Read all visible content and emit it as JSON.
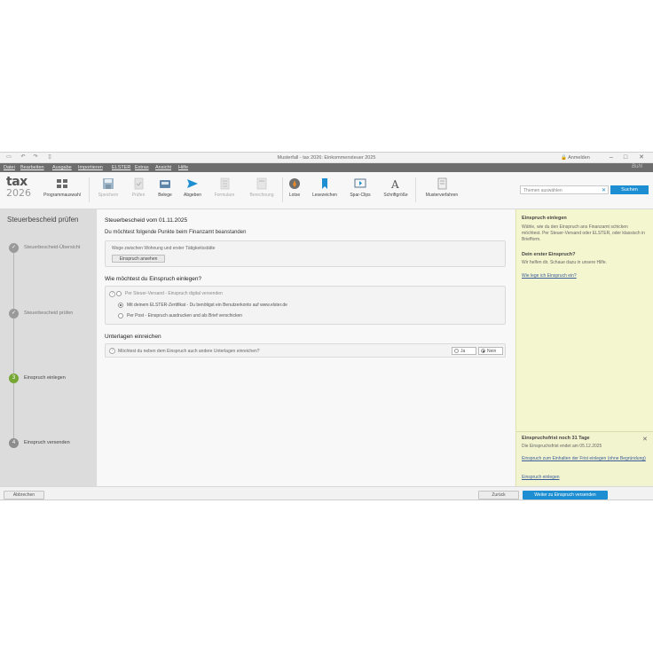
{
  "window": {
    "title": "Musterfall - tax 2026: Einkommensteuer 2025",
    "login_label": "Anmelden"
  },
  "menu": [
    "Datei",
    "Bearbeiten",
    "Ausgabe",
    "Importieren",
    "ELSTER",
    "Extras",
    "Ansicht",
    "Hilfe"
  ],
  "brand": "Buhl",
  "logo": {
    "line1": "tax",
    "line2": "2026"
  },
  "ribbon": [
    {
      "label": "Programmauswahl",
      "icon": "grid-icon",
      "disabled": false
    },
    {
      "label": "Speichern",
      "icon": "save-icon",
      "disabled": true
    },
    {
      "label": "Prüfen",
      "icon": "check-document-icon",
      "disabled": true
    },
    {
      "label": "Belege",
      "icon": "inbox-icon",
      "disabled": false
    },
    {
      "label": "Abgeben",
      "icon": "send-icon",
      "disabled": false
    },
    {
      "label": "Formulare",
      "icon": "form-icon",
      "disabled": true
    },
    {
      "label": "Berechnung",
      "icon": "calculator-icon",
      "disabled": true
    },
    {
      "label": "Lotse",
      "icon": "compass-icon",
      "disabled": false
    },
    {
      "label": "Lesezeichen",
      "icon": "bookmark-icon",
      "disabled": false
    },
    {
      "label": "Spar-Clips",
      "icon": "play-icon",
      "disabled": false
    },
    {
      "label": "Schriftgröße",
      "icon": "font-size-icon",
      "disabled": false
    },
    {
      "label": "Musterverfahren",
      "icon": "document-icon",
      "disabled": false
    }
  ],
  "search": {
    "placeholder": "Themen auswählen",
    "button": "Suchen"
  },
  "leftnav": {
    "title": "Steuerbescheid prüfen",
    "steps": [
      {
        "label": "Steuerbescheid-Übersicht",
        "marker": "✓",
        "state": "done"
      },
      {
        "label": "Steuerbescheid prüfen",
        "marker": "✓",
        "state": "done"
      },
      {
        "label": "Einspruch einlegen",
        "marker": "3",
        "state": "active"
      },
      {
        "label": "Einspruch versenden",
        "marker": "4",
        "state": "future"
      }
    ]
  },
  "main": {
    "heading": "Steuerbescheid vom 01.11.2025",
    "complaint_heading": "Du möchtest folgende Punkte beim Finanzamt beanstanden",
    "complaint_item": "Wege zwischen Wohnung und erster Tätigkeitsstätte",
    "complaint_button": "Einspruch ansehen",
    "method_heading": "Wie möchtest du Einspruch einlegen?",
    "options": [
      {
        "label": "Per Steuer-Versand - Einspruch digital versenden",
        "selected": false,
        "dim": true
      },
      {
        "label": "Mit deinem ELSTER-Zertifikat - Du benötigst ein Benutzerkonto auf www.elster.de",
        "selected": true,
        "dim": false
      },
      {
        "label": "Per Post - Einspruch ausdrucken und als Brief verschicken",
        "selected": false,
        "dim": false
      }
    ],
    "docs_heading": "Unterlagen einreichen",
    "docs_question": "Möchtest du neben dem Einspruch auch andere Unterlagen einreichen?",
    "yes": "Ja",
    "no": "Nein"
  },
  "right": {
    "h1": "Einspruch einlegen",
    "p1": "Wähle, wie du den Einspruch ans Finanzamt schicken möchtest. Per Steuer-Versand oder ELSTER, oder klassisch in Briefform.",
    "h2": "Dein erster Einspruch?",
    "p2": "Wir helfen dir. Schaue dazu in unsere Hilfe.",
    "link1": "Wie lege ich Einspruch ein?",
    "box_title": "Einspruchsfrist noch 31 Tage",
    "box_text": "Die Einspruchsfrist endet am 05.12.2025",
    "box_link1": "Einspruch zum Einhalten der Frist einlegen (ohne Begründung)",
    "box_link2": "Einspruch einlegen"
  },
  "bottom": {
    "cancel": "Abbrechen",
    "back": "Zurück",
    "next": "Weiter zu Einspruch versenden"
  }
}
